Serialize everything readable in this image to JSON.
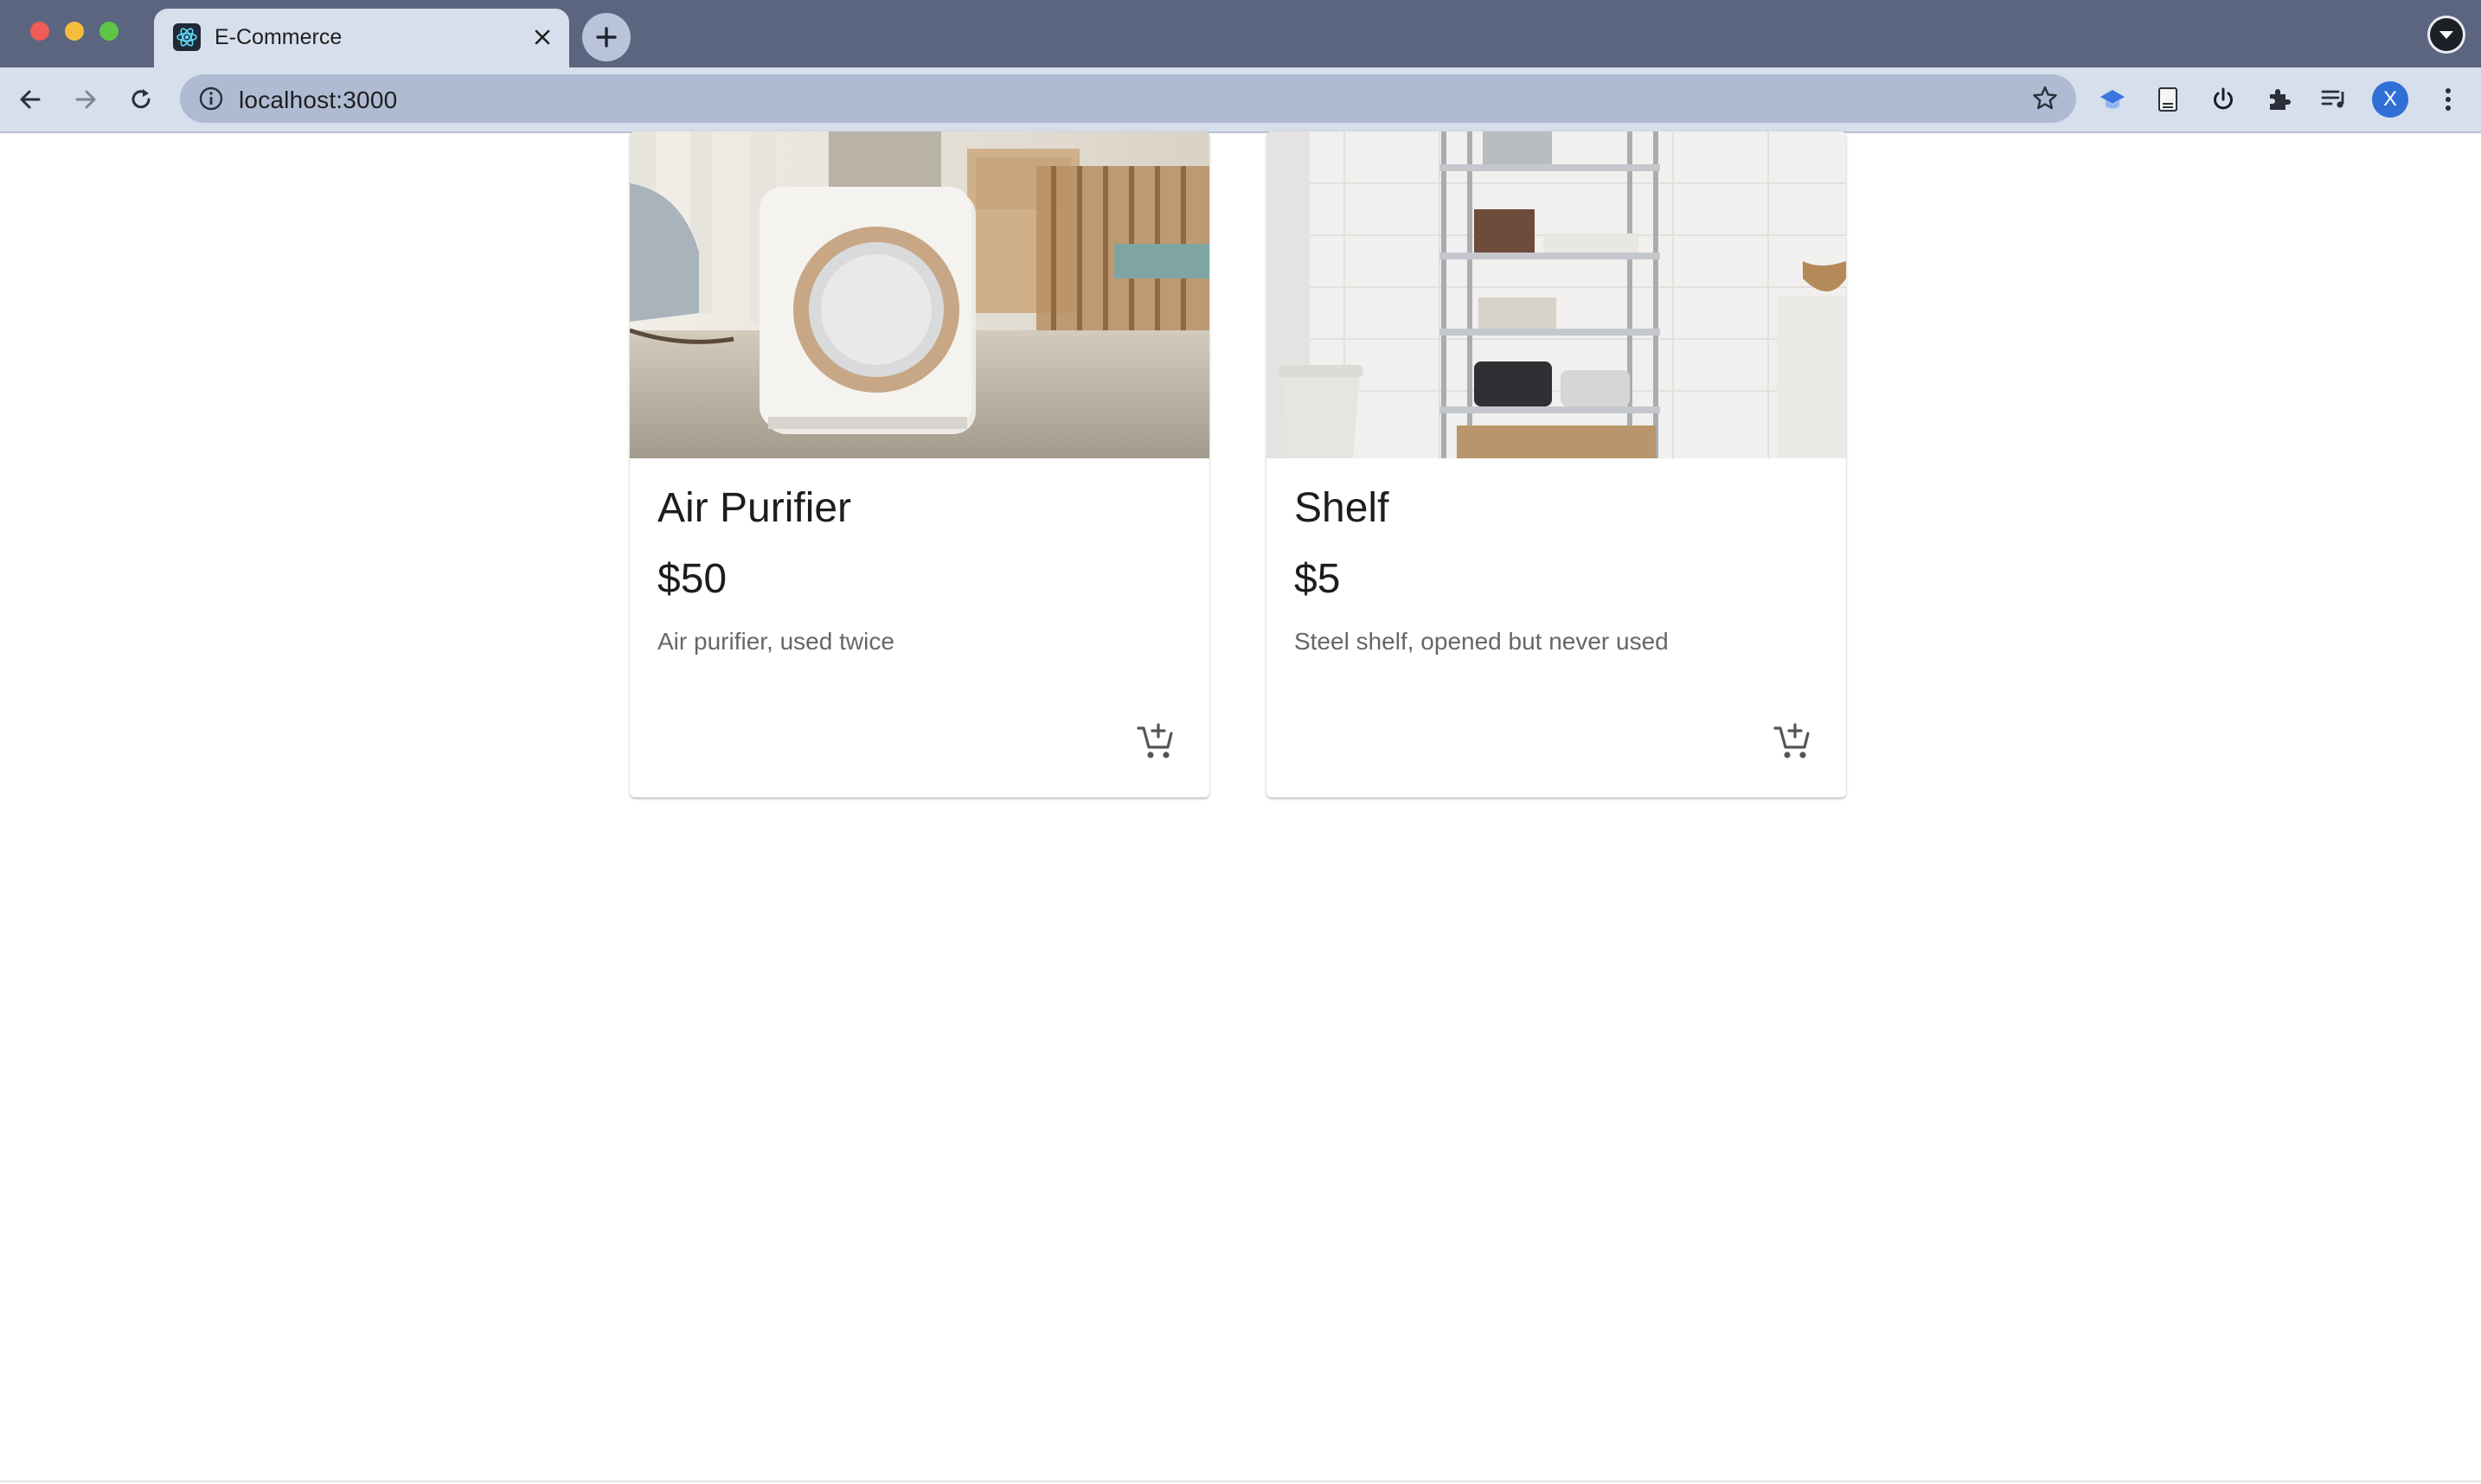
{
  "browser": {
    "tab_title": "E-Commerce",
    "url": "localhost:3000",
    "profile_initial": "X"
  },
  "products": [
    {
      "title": "Air Purifier",
      "price": "$50",
      "description": "Air purifier, used twice",
      "image_alt": "Air purifier photo"
    },
    {
      "title": "Shelf",
      "price": "$5",
      "description": "Steel shelf, opened but never used",
      "image_alt": "Steel shelf photo"
    }
  ],
  "colors": {
    "tabbar": "#5b6580",
    "toolbar": "#d7deec",
    "omnibox": "#aebbd2",
    "text_primary": "#1d1d1d",
    "text_secondary": "#666666"
  }
}
